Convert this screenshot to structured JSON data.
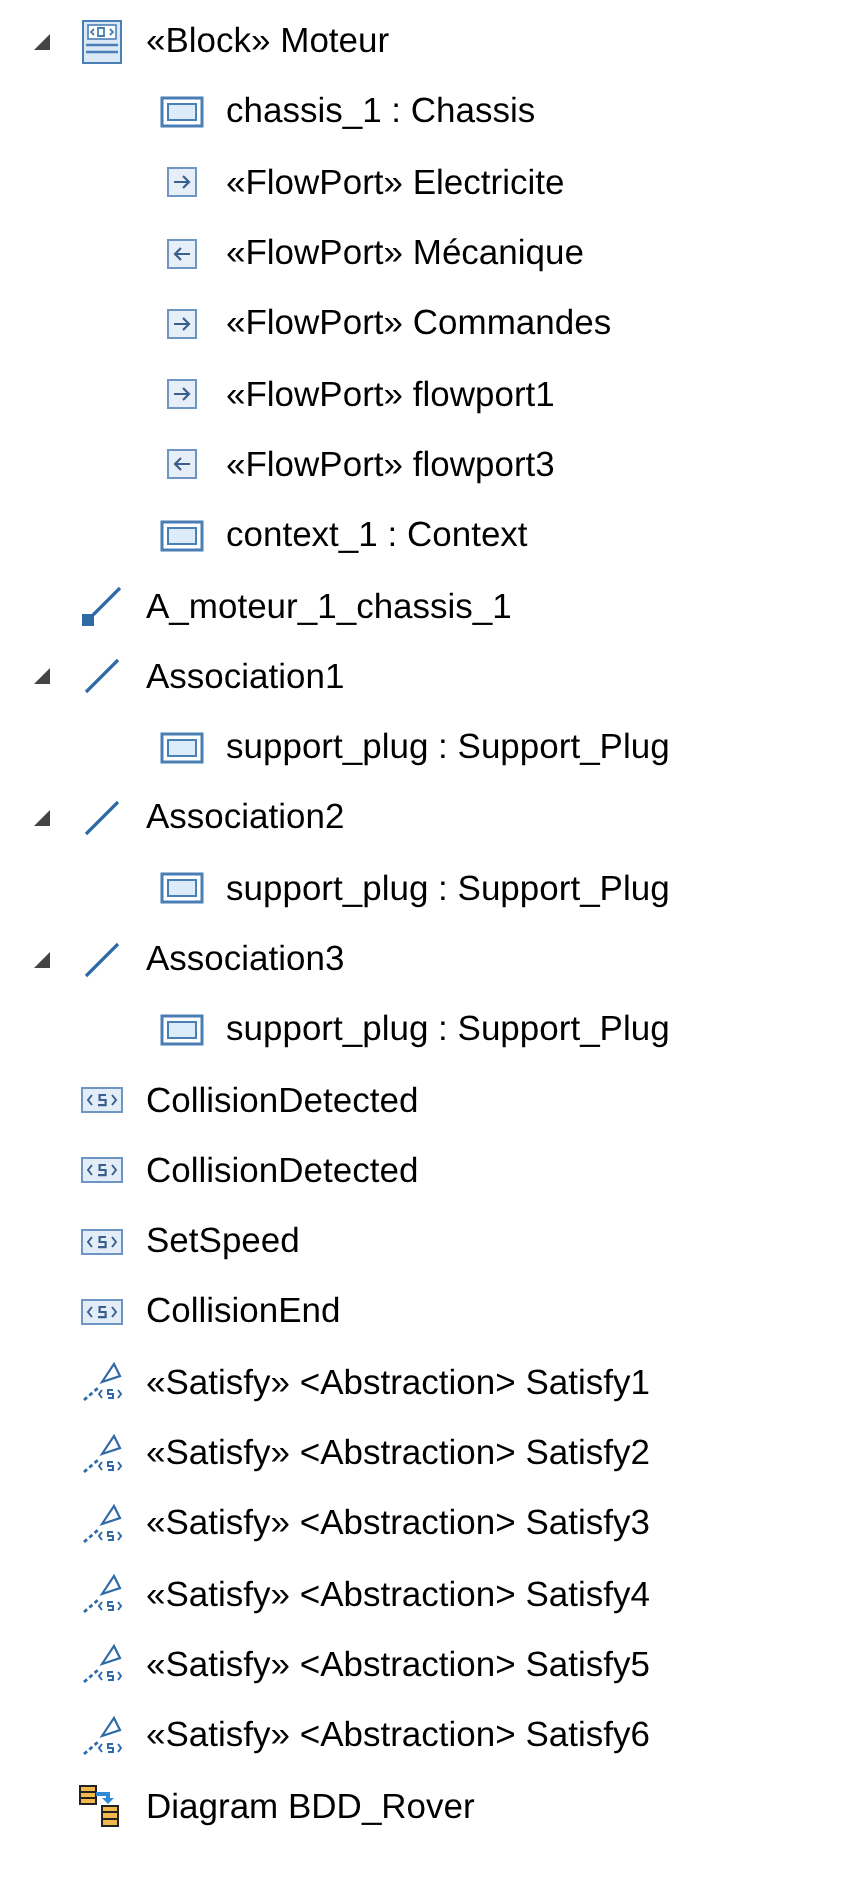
{
  "tree": [
    {
      "kind": "block",
      "label": "«Block» Moteur",
      "expanded": true,
      "children": [
        {
          "kind": "part",
          "label": "chassis_1 : Chassis"
        },
        {
          "kind": "flowport-in",
          "label": "«FlowPort» Electricite"
        },
        {
          "kind": "flowport-out",
          "label": "«FlowPort» Mécanique"
        },
        {
          "kind": "flowport-in",
          "label": "«FlowPort» Commandes"
        },
        {
          "kind": "flowport-in",
          "label": "«FlowPort» flowport1"
        },
        {
          "kind": "flowport-out",
          "label": "«FlowPort» flowport3"
        },
        {
          "kind": "part",
          "label": "context_1 : Context"
        }
      ]
    },
    {
      "kind": "connector",
      "label": "A_moteur_1_chassis_1"
    },
    {
      "kind": "association",
      "label": "Association1",
      "expanded": true,
      "children": [
        {
          "kind": "part",
          "label": "support_plug : Support_Plug"
        }
      ]
    },
    {
      "kind": "association",
      "label": "Association2",
      "expanded": true,
      "children": [
        {
          "kind": "part",
          "label": "support_plug : Support_Plug"
        }
      ]
    },
    {
      "kind": "association",
      "label": "Association3",
      "expanded": true,
      "children": [
        {
          "kind": "part",
          "label": "support_plug : Support_Plug"
        }
      ]
    },
    {
      "kind": "signal",
      "label": "CollisionDetected"
    },
    {
      "kind": "signal",
      "label": "CollisionDetected"
    },
    {
      "kind": "signal",
      "label": "SetSpeed"
    },
    {
      "kind": "signal",
      "label": "CollisionEnd"
    },
    {
      "kind": "satisfy",
      "label": "«Satisfy» <Abstraction> Satisfy1"
    },
    {
      "kind": "satisfy",
      "label": "«Satisfy» <Abstraction> Satisfy2"
    },
    {
      "kind": "satisfy",
      "label": "«Satisfy» <Abstraction> Satisfy3"
    },
    {
      "kind": "satisfy",
      "label": "«Satisfy» <Abstraction> Satisfy4"
    },
    {
      "kind": "satisfy",
      "label": "«Satisfy» <Abstraction> Satisfy5"
    },
    {
      "kind": "satisfy",
      "label": "«Satisfy» <Abstraction> Satisfy6"
    },
    {
      "kind": "diagram",
      "label": "Diagram BDD_Rover"
    }
  ]
}
